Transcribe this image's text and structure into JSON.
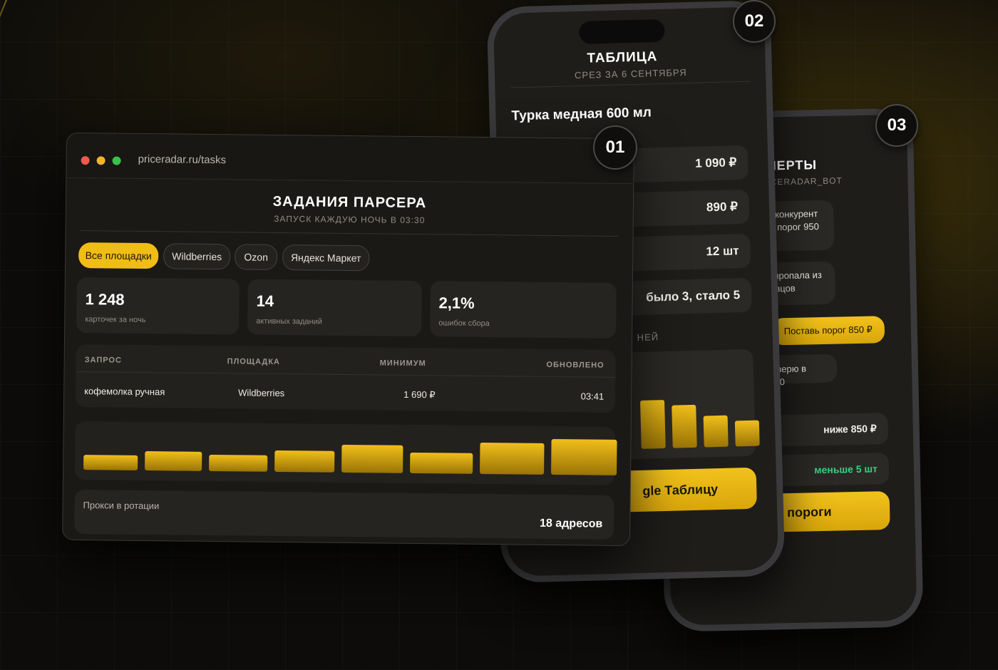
{
  "phone2": {
    "badge": "02",
    "title": "ТАБЛИЦА",
    "subtitle": "СРЕЗ ЗА 6 СЕНТЯБРЯ",
    "product": "Турка медная 600 мл",
    "rows": [
      "1 090 ₽",
      "890 ₽",
      "12 шт",
      "было 3, стало 5"
    ],
    "section_fragment": "НЕЙ",
    "bars": [
      0.85,
      0.75,
      0.55,
      0.45
    ],
    "button_fragment": "gle Таблицу"
  },
  "phone3": {
    "badge": "03",
    "title_fragment": "ЛЕРТЫ",
    "subtitle_fragment": "ICERADAR_BOT",
    "msg1": "мл: конкурент\n0 ₽, порог 950",
    "msg2": "мл пропала из\nодавцов",
    "reply": "Поставь порог 850 ₽",
    "msg3": "проверю в 03:30",
    "rows": [
      "ниже 850 ₽",
      "меньше 5 шт"
    ],
    "button_fragment": "ить пороги",
    "accent_green": "#35d07f"
  },
  "window": {
    "badge": "01",
    "url": "priceradar.ru/tasks",
    "title": "ЗАДАНИЯ ПАРСЕРА",
    "subtitle": "ЗАПУСК КАЖДУЮ НОЧЬ В 03:30",
    "filters": [
      "Все площадки",
      "Wildberries",
      "Ozon",
      "Яндекс Маркет"
    ],
    "stats": [
      {
        "value": "1 248",
        "label": "карточек за ночь"
      },
      {
        "value": "14",
        "label": "активных заданий"
      },
      {
        "value": "2,1%",
        "label": "ошибок сбора"
      }
    ],
    "table": {
      "headers": [
        "ЗАПРОС",
        "ПЛОЩАДКА",
        "МИНИМУМ",
        "ОБНОВЛЕНО"
      ],
      "row": [
        "кофемолка ручная",
        "Wildberries",
        "1 690 ₽",
        "03:41"
      ]
    },
    "bars": [
      0.36,
      0.46,
      0.4,
      0.52,
      0.68,
      0.5,
      0.76,
      0.86
    ],
    "proxy_label": "Прокси в ротации",
    "proxy_value": "18 адресов"
  },
  "colors": {
    "accent": "#f0bd16",
    "background": "#0d0c0a"
  }
}
